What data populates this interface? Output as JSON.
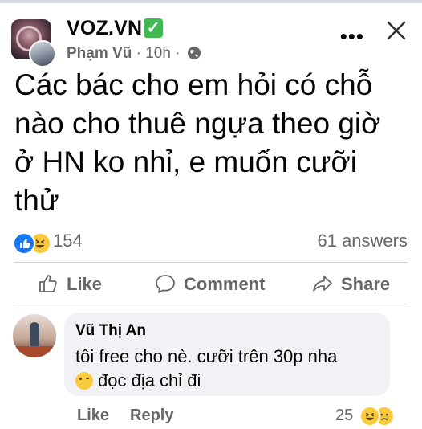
{
  "header": {
    "group_name": "VOZ.VN",
    "verified_glyph": "✓",
    "author": "Phạm Vũ",
    "separator": " · ",
    "time": "10h",
    "more_glyph": "•••"
  },
  "post": {
    "lines": [
      "Các bác cho em hỏi có chỗ",
      "nào cho thuê ngựa theo giờ",
      "ở HN ko nhỉ, e muốn cưỡi",
      "thử"
    ]
  },
  "stats": {
    "reaction_icons": [
      "like-icon",
      "haha-icon"
    ],
    "reaction_count": "154",
    "answers": "61 answers"
  },
  "actions": {
    "like": "Like",
    "comment": "Comment",
    "share": "Share"
  },
  "comment": {
    "author": "Vũ Thị An",
    "line1": "tôi free cho nè. cưỡi trên 30p nha",
    "line2": "đọc địa chỉ đi",
    "inline_icon": "kissing-face-icon",
    "like_label": "Like",
    "reply_label": "Reply",
    "reaction_count": "25",
    "reaction_icons": [
      "haha-icon",
      "sad-icon"
    ]
  },
  "colors": {
    "verified": "#3fb950",
    "like_blue": "#1877f2",
    "secondary_text": "#65676b",
    "bubble_bg": "#f0f2f5"
  }
}
